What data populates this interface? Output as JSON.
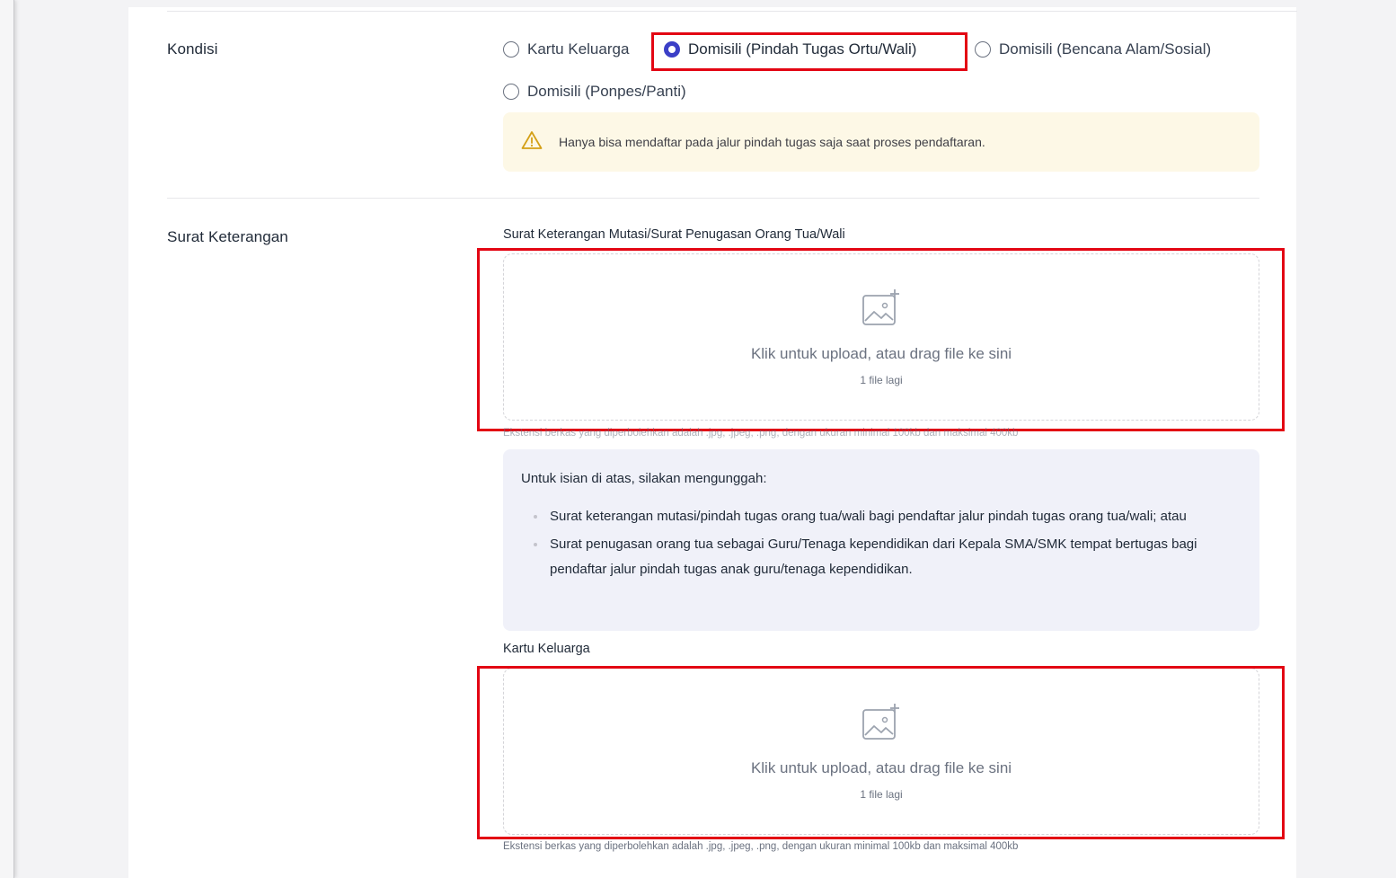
{
  "kondisi": {
    "label": "Kondisi",
    "options": [
      {
        "label": "Kartu Keluarga",
        "checked": false
      },
      {
        "label": "Domisili (Pindah Tugas Ortu/Wali)",
        "checked": true
      },
      {
        "label": "Domisili (Bencana Alam/Sosial)",
        "checked": false
      },
      {
        "label": "Domisili (Ponpes/Panti)",
        "checked": false
      }
    ],
    "warning": "Hanya bisa mendaftar pada jalur pindah tugas saja saat proses pendaftaran.",
    "warning_icon": "warning-triangle-icon"
  },
  "surat": {
    "label": "Surat Keterangan",
    "upload1": {
      "title": "Surat Keterangan Mutasi/Surat Penugasan Orang Tua/Wali",
      "main": "Klik untuk upload, atau drag file ke sini",
      "sub": "1 file lagi",
      "note": "Ekstensi berkas yang diperbolehkan adalah .jpg, .jpeg, .png, dengan ukuran minimal 100kb dan maksimal 400kb",
      "icon": "image-add-icon"
    },
    "info": {
      "intro": "Untuk isian di atas, silakan mengunggah:",
      "items": [
        "Surat keterangan mutasi/pindah tugas orang tua/wali bagi pendaftar jalur pindah tugas orang tua/wali; atau",
        "Surat penugasan orang tua sebagai Guru/Tenaga kependidikan dari Kepala SMA/SMK tempat bertugas bagi pendaftar jalur pindah tugas anak guru/tenaga kependidikan."
      ]
    },
    "upload2": {
      "title": "Kartu Keluarga",
      "main": "Klik untuk upload, atau drag file ke sini",
      "sub": "1 file lagi",
      "note": "Ekstensi berkas yang diperbolehkan adalah .jpg, .jpeg, .png, dengan ukuran minimal 100kb dan maksimal 400kb",
      "icon": "image-add-icon"
    }
  },
  "colors": {
    "accent": "#3b3fc7",
    "highlight": "#e30613",
    "warning_bg": "#fdf8e6",
    "info_bg": "#f0f1f9"
  }
}
